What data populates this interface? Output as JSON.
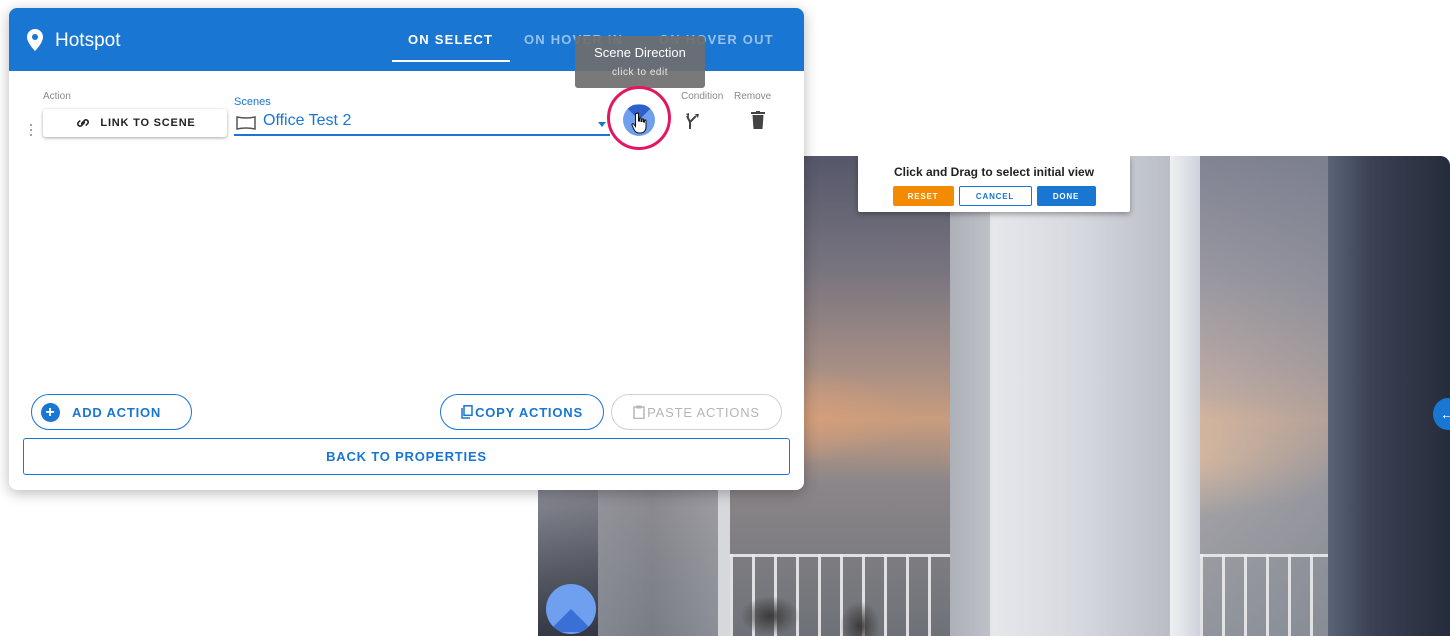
{
  "dialog": {
    "title": "Hotspot",
    "tabs": [
      {
        "label": "ON SELECT",
        "active": true
      },
      {
        "label": "ON HOVER IN",
        "active": false
      },
      {
        "label": "ON HOVER OUT",
        "active": false
      }
    ]
  },
  "action_row": {
    "action_label": "Action",
    "action_button": "LINK TO SCENE",
    "scenes_label": "Scenes",
    "scene_value": "Office Test 2",
    "condition_label": "Condition",
    "remove_label": "Remove"
  },
  "tooltip": {
    "title": "Scene Direction",
    "subtitle": "click to edit"
  },
  "footer": {
    "add_action": "ADD ACTION",
    "copy_actions": "COPY ACTIONS",
    "paste_actions": "PASTE ACTIONS",
    "back": "BACK TO PROPERTIES"
  },
  "viewer": {
    "instruction": "Click and Drag to select initial view",
    "reset": "RESET",
    "cancel": "CANCEL",
    "done": "DONE"
  },
  "colors": {
    "primary": "#1976d2",
    "reset": "#f28b00",
    "highlight": "#e3175f"
  }
}
